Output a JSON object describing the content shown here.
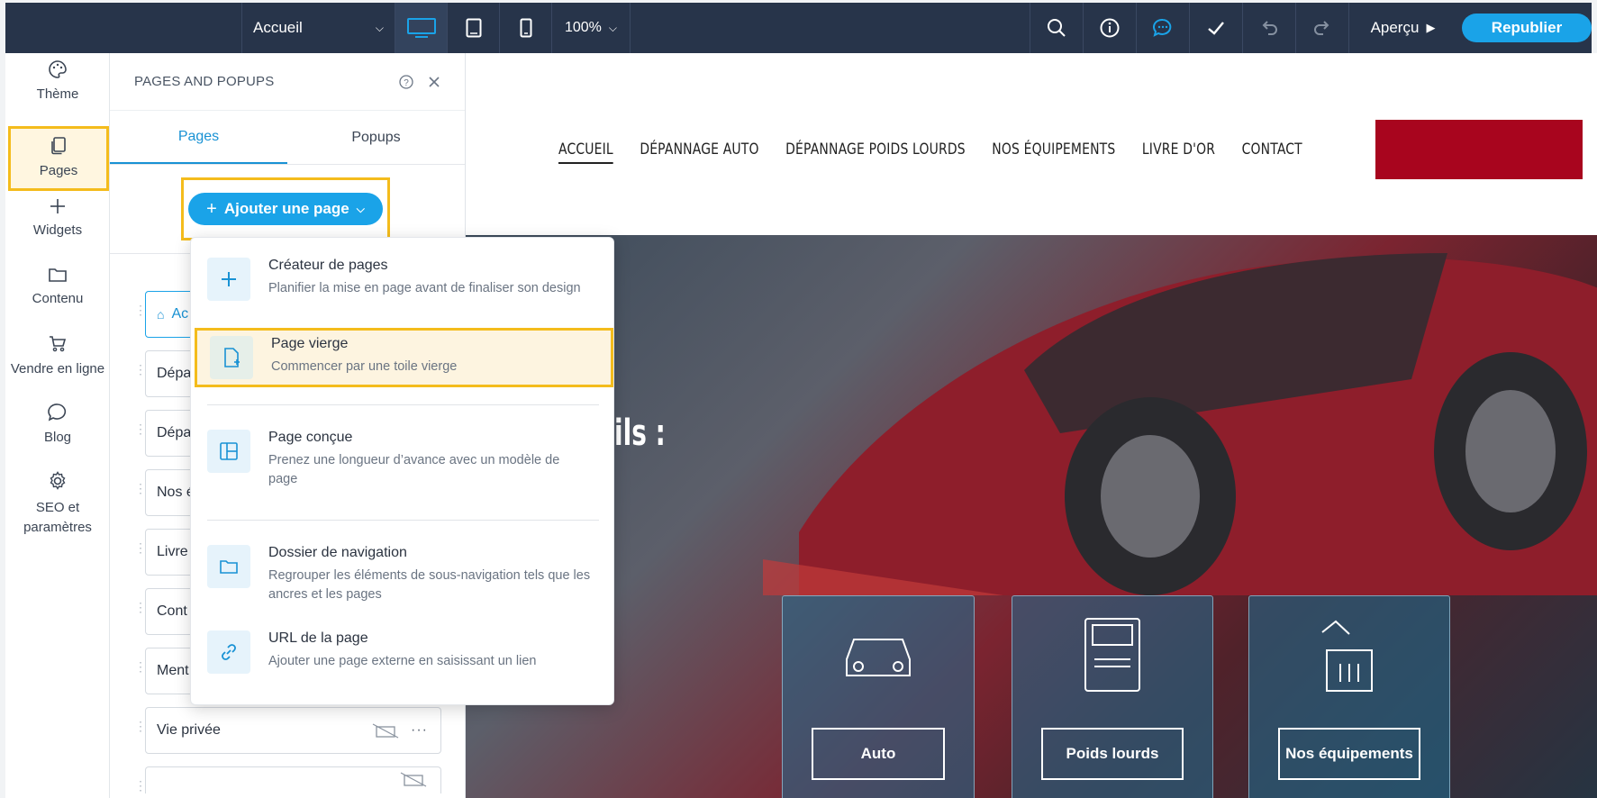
{
  "topbar": {
    "page_select": "Accueil",
    "zoom": "100%",
    "preview": "Aperçu",
    "publish": "Republier"
  },
  "rail": {
    "items": [
      {
        "label": "Thème"
      },
      {
        "label": "Pages"
      },
      {
        "label": "Widgets"
      },
      {
        "label": "Contenu"
      },
      {
        "label": "Vendre en ligne"
      },
      {
        "label": "Blog"
      },
      {
        "label": "SEO et paramètres"
      }
    ]
  },
  "panel": {
    "title": "PAGES AND POPUPS",
    "tabs": [
      {
        "label": "Pages"
      },
      {
        "label": "Popups"
      }
    ],
    "add_button": "Ajouter une page",
    "pages": [
      {
        "label": "Ac"
      },
      {
        "label": "Dépa"
      },
      {
        "label": "Dépa"
      },
      {
        "label": "Nos é"
      },
      {
        "label": "Livre"
      },
      {
        "label": "Cont"
      },
      {
        "label": "Ment"
      },
      {
        "label": "Vie privée"
      }
    ]
  },
  "menu": {
    "items": [
      {
        "title": "Créateur de pages",
        "desc": "Planifier la mise en page avant de finaliser son design"
      },
      {
        "title": "Page vierge",
        "desc": "Commencer par une toile vierge"
      },
      {
        "title": "Page conçue",
        "desc": "Prenez une longueur d’avance avec un modèle de page"
      },
      {
        "title": "Dossier de navigation",
        "desc": "Regrouper les éléments de sous-navigation tels que les ancres et les pages"
      },
      {
        "title": "URL de la page",
        "desc": "Ajouter une page externe en saisissant un lien"
      }
    ]
  },
  "site": {
    "nav": [
      "ACCUEIL",
      "DÉPANNAGE AUTO",
      "DÉPANNAGE POIDS LOURDS",
      "NOS ÉQUIPEMENTS",
      "LIVRE D'OR",
      "CONTACT"
    ],
    "hero_heading_fragment": "ils :",
    "cards": [
      {
        "label": "Auto"
      },
      {
        "label": "Poids lourds"
      },
      {
        "label": "Nos équipements"
      }
    ]
  },
  "colors": {
    "toolbar": "#27344a",
    "accent": "#1aa3e8",
    "highlight": "#f4bc1c",
    "brand_red": "#a8051e"
  }
}
